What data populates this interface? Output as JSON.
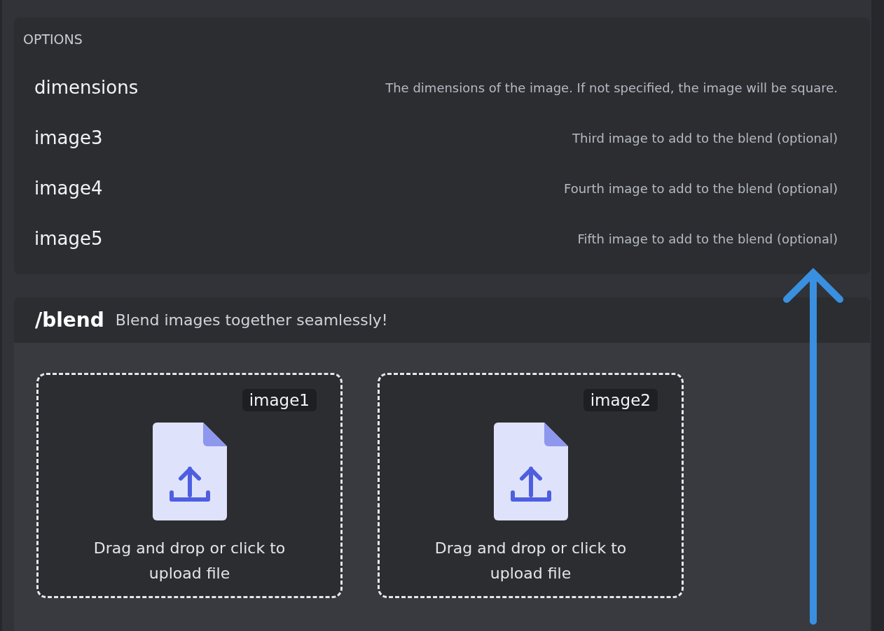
{
  "options_panel": {
    "heading": "OPTIONS",
    "options": [
      {
        "name": "dimensions",
        "description": "The dimensions of the image. If not specified, the image will be square."
      },
      {
        "name": "image3",
        "description": "Third image to add to the blend (optional)"
      },
      {
        "name": "image4",
        "description": "Fourth image to add to the blend (optional)"
      },
      {
        "name": "image5",
        "description": "Fifth image to add to the blend (optional)"
      }
    ]
  },
  "command": {
    "name": "/blend",
    "description": "Blend images together seamlessly!"
  },
  "uploads": [
    {
      "label": "image1",
      "prompt": "Drag and drop or click to upload file"
    },
    {
      "label": "image2",
      "prompt": "Drag and drop or click to upload file"
    }
  ]
}
